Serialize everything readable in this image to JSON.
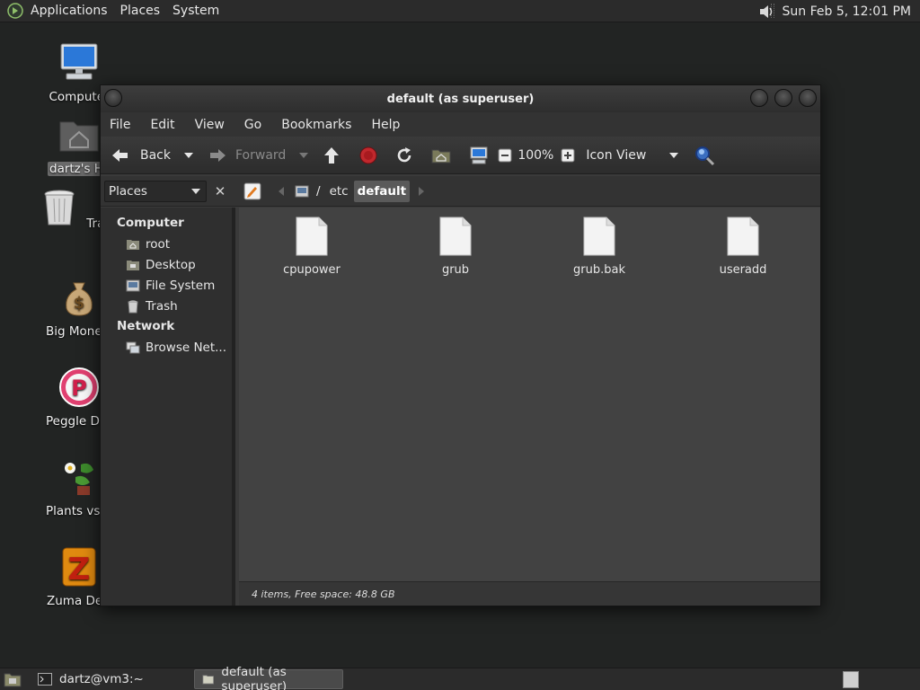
{
  "top_panel": {
    "menus": [
      "Applications",
      "Places",
      "System"
    ],
    "clock": "Sun Feb  5, 12:01 PM"
  },
  "desktop": {
    "icons": [
      {
        "label": "Computer"
      },
      {
        "label": "dartz's Home"
      },
      {
        "label": "Trash"
      },
      {
        "label": "Big Money Deluxe"
      },
      {
        "label": "Peggle Deluxe"
      },
      {
        "label": "Plants vs Zombies"
      },
      {
        "label": "Zuma Deluxe"
      }
    ]
  },
  "window": {
    "title": "default (as superuser)",
    "menu": [
      "File",
      "Edit",
      "View",
      "Go",
      "Bookmarks",
      "Help"
    ],
    "toolbar": {
      "back": "Back",
      "forward": "Forward",
      "zoom": "100%",
      "view_mode": "Icon View"
    },
    "places_combo": "Places",
    "path": [
      "/",
      "etc",
      "default"
    ],
    "sidebar": {
      "sections": [
        {
          "heading": "Computer",
          "items": [
            "root",
            "Desktop",
            "File System",
            "Trash"
          ]
        },
        {
          "heading": "Network",
          "items": [
            "Browse Net..."
          ]
        }
      ]
    },
    "files": [
      "cpupower",
      "grub",
      "grub.bak",
      "useradd"
    ],
    "status": "4 items, Free space: 48.8 GB"
  },
  "taskbar": {
    "tasks": [
      {
        "label": "dartz@vm3:~"
      },
      {
        "label": "default (as superuser)"
      }
    ]
  },
  "colors": {
    "desktop_bg": "#222423",
    "panel_bg": "#2b2b2b",
    "content_bg": "#424242",
    "stop_red": "#c0282d"
  }
}
